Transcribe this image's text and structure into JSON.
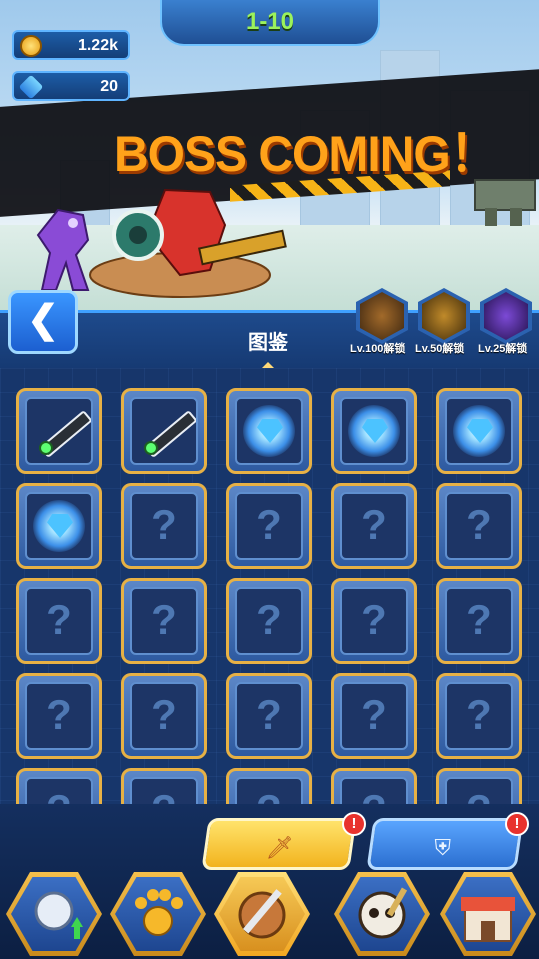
{
  "header": {
    "stage": "1-10",
    "coins": "1.22k",
    "gems": "20",
    "banner": "BOSS COMING！"
  },
  "collection": {
    "title": "图鉴",
    "back_icon": "chevron-left-icon",
    "locked_slots": [
      {
        "label": "Lv.100解锁",
        "icon": "chest-icon"
      },
      {
        "label": "Lv.50解锁",
        "icon": "sword-altar-icon"
      },
      {
        "label": "Lv.25解锁",
        "icon": "dark-warrior-icon"
      }
    ],
    "cells": [
      {
        "state": "weapon",
        "icon": "cannon-icon"
      },
      {
        "state": "weapon",
        "icon": "cannon-icon"
      },
      {
        "state": "discovered",
        "icon": "glowing-crystal-icon"
      },
      {
        "state": "discovered",
        "icon": "glowing-crystal-icon"
      },
      {
        "state": "discovered",
        "icon": "glowing-crystal-icon"
      },
      {
        "state": "discovered",
        "icon": "glowing-crystal-icon"
      },
      {
        "state": "unknown",
        "label": "?"
      },
      {
        "state": "unknown",
        "label": "?"
      },
      {
        "state": "unknown",
        "label": "?"
      },
      {
        "state": "unknown",
        "label": "?"
      },
      {
        "state": "unknown",
        "label": "?"
      },
      {
        "state": "unknown",
        "label": "?"
      },
      {
        "state": "unknown",
        "label": "?"
      },
      {
        "state": "unknown",
        "label": "?"
      },
      {
        "state": "unknown",
        "label": "?"
      },
      {
        "state": "unknown",
        "label": "?"
      },
      {
        "state": "unknown",
        "label": "?"
      },
      {
        "state": "unknown",
        "label": "?"
      },
      {
        "state": "unknown",
        "label": "?"
      },
      {
        "state": "unknown",
        "label": "?"
      },
      {
        "state": "unknown",
        "label": "?"
      },
      {
        "state": "unknown",
        "label": "?"
      },
      {
        "state": "unknown",
        "label": "?"
      },
      {
        "state": "unknown",
        "label": "?"
      },
      {
        "state": "unknown",
        "label": "?"
      }
    ]
  },
  "modes": {
    "weapon": {
      "icon": "sword-icon",
      "badge": "!",
      "color": "#f6d04c"
    },
    "armor": {
      "icon": "shield-icon",
      "badge": "!",
      "color": "#4d95e8"
    }
  },
  "nav": [
    {
      "icon": "hero-upgrade-icon"
    },
    {
      "icon": "paw-icon"
    },
    {
      "icon": "sword-shield-icon",
      "active": true
    },
    {
      "icon": "skull-pirate-icon"
    },
    {
      "icon": "shop-icon"
    }
  ]
}
